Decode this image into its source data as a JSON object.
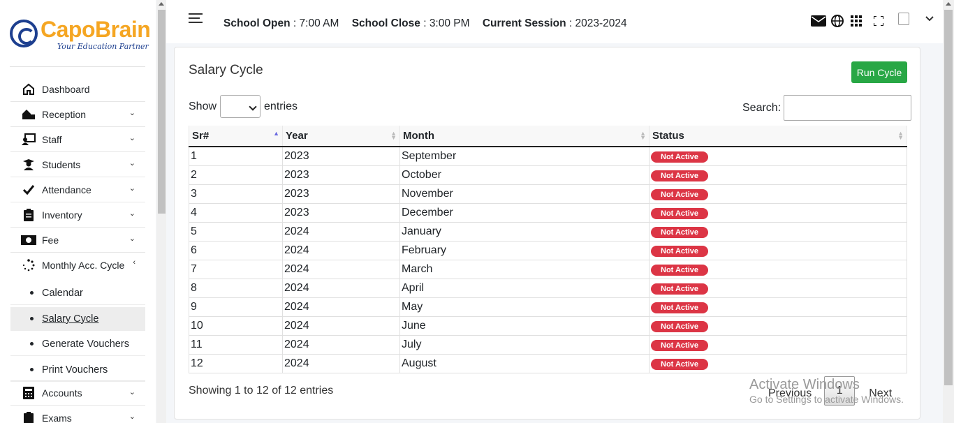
{
  "brand": {
    "name_part1": "Capo",
    "name_part2": "Brain",
    "tagline": "Your Education Partner"
  },
  "sidebar": {
    "items": [
      {
        "label": "Dashboard",
        "icon": "home-icon",
        "has_chevron": false
      },
      {
        "label": "Reception",
        "icon": "reception-icon",
        "has_chevron": true
      },
      {
        "label": "Staff",
        "icon": "staff-icon",
        "has_chevron": true
      },
      {
        "label": "Students",
        "icon": "student-icon",
        "has_chevron": true
      },
      {
        "label": "Attendance",
        "icon": "check-icon",
        "has_chevron": true
      },
      {
        "label": "Inventory",
        "icon": "clipboard-icon",
        "has_chevron": true
      },
      {
        "label": "Fee",
        "icon": "money-icon",
        "has_chevron": true
      },
      {
        "label": "Monthly Acc. Cycle",
        "icon": "spinner-icon",
        "has_chevron": true,
        "expanded": true
      },
      {
        "label": "Accounts",
        "icon": "calculator-icon",
        "has_chevron": true
      },
      {
        "label": "Exams",
        "icon": "clipboard-icon",
        "has_chevron": true
      }
    ],
    "sub_items": [
      {
        "label": "Calendar",
        "active": false
      },
      {
        "label": "Salary Cycle",
        "active": true
      },
      {
        "label": "Generate Vouchers",
        "active": false
      },
      {
        "label": "Print Vouchers",
        "active": false
      }
    ]
  },
  "topbar": {
    "school_open_label": "School Open",
    "school_open_value": "7:00 AM",
    "school_close_label": "School Close",
    "school_close_value": "3:00 PM",
    "session_label": "Current Session",
    "session_value": "2023-2024",
    "icons": [
      "envelope-icon",
      "globe-icon",
      "grid-icon",
      "fullscreen-icon"
    ]
  },
  "page": {
    "title": "Salary Cycle",
    "run_button": "Run Cycle",
    "show_label": "Show",
    "entries_label": "entries",
    "search_label": "Search:",
    "info": "Showing 1 to 12 of 12 entries",
    "pagination": {
      "previous": "Previous",
      "current": "1",
      "next": "Next"
    }
  },
  "table": {
    "columns": [
      "Sr#",
      "Year",
      "Month",
      "Status"
    ],
    "rows": [
      {
        "sr": "1",
        "year": "2023",
        "month": "September",
        "status": "Not Active"
      },
      {
        "sr": "2",
        "year": "2023",
        "month": "October",
        "status": "Not Active"
      },
      {
        "sr": "3",
        "year": "2023",
        "month": "November",
        "status": "Not Active"
      },
      {
        "sr": "4",
        "year": "2023",
        "month": "December",
        "status": "Not Active"
      },
      {
        "sr": "5",
        "year": "2024",
        "month": "January",
        "status": "Not Active"
      },
      {
        "sr": "6",
        "year": "2024",
        "month": "February",
        "status": "Not Active"
      },
      {
        "sr": "7",
        "year": "2024",
        "month": "March",
        "status": "Not Active"
      },
      {
        "sr": "8",
        "year": "2024",
        "month": "April",
        "status": "Not Active"
      },
      {
        "sr": "9",
        "year": "2024",
        "month": "May",
        "status": "Not Active"
      },
      {
        "sr": "10",
        "year": "2024",
        "month": "June",
        "status": "Not Active"
      },
      {
        "sr": "11",
        "year": "2024",
        "month": "July",
        "status": "Not Active"
      },
      {
        "sr": "12",
        "year": "2024",
        "month": "August",
        "status": "Not Active"
      }
    ]
  },
  "watermark": {
    "line1": "Activate Windows",
    "line2": "Go to Settings to activate Windows."
  },
  "colors": {
    "accent_green": "#28a745",
    "badge_red": "#dc3545",
    "brand_orange": "#f5a623",
    "brand_blue": "#1d3f8f"
  }
}
